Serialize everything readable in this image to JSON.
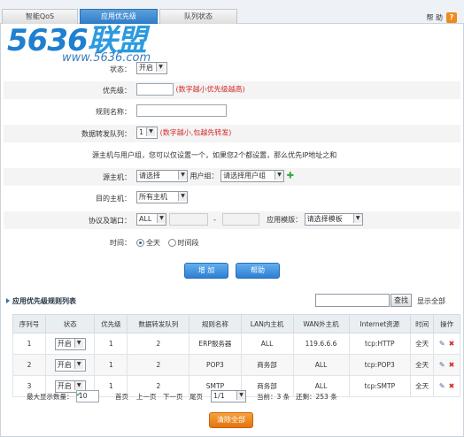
{
  "tabs": [
    "智能QoS",
    "应用优先级",
    "队列状态"
  ],
  "help_label": "帮 助",
  "help_icon": "?",
  "logo": {
    "text": "5636",
    "cn": "联盟",
    "url": "www.5636.com"
  },
  "form": {
    "status_label": "状态：",
    "status_value": "开启",
    "priority_label": "优先级：",
    "priority_hint": "(数字越小优先级越高)",
    "rule_name_label": "规则名称：",
    "queue_label": "数据转发队列：",
    "queue_value": "1",
    "queue_hint": "(数字越小,包越先转发)",
    "note": "源主机与用户组，您可以仅设置一个，如果您2个都设置，那么优先IP地址之和",
    "src_host_label": "源主机：",
    "src_host_value": "请选择",
    "user_group_label": "用户组：",
    "user_group_value": "请选择用户组",
    "dst_queue_label": "目的主机：",
    "dst_queue_value": "所有主机",
    "proto_label": "协议及端口：",
    "proto_value": "ALL",
    "port_sep": "-",
    "app_template_label": "应用模版：",
    "app_template_value": "请选择模板",
    "time_label": "时间：",
    "time_opt1": "全天",
    "time_opt2": "时间段",
    "add_button": "增 加",
    "help_button": "帮助"
  },
  "list": {
    "title": "应用优先级规则列表",
    "search_button": "查找",
    "show_all": "显示全部",
    "columns": [
      "序列号",
      "状态",
      "优先级",
      "数据转发队列",
      "规则名称",
      "LAN内主机",
      "WAN外主机",
      "Internet资源",
      "时间",
      "操作"
    ],
    "rows": [
      {
        "id": "1",
        "status": "开启",
        "priority": "1",
        "queue": "2",
        "name": "ERP服务器",
        "lan": "ALL",
        "wan": "119.6.6.6",
        "res": "tcp:HTTP",
        "time": "全天"
      },
      {
        "id": "2",
        "status": "开启",
        "priority": "1",
        "queue": "2",
        "name": "POP3",
        "lan": "商务部",
        "wan": "ALL",
        "res": "tcp:POP3",
        "time": "全天"
      },
      {
        "id": "3",
        "status": "开启",
        "priority": "1",
        "queue": "2",
        "name": "SMTP",
        "lan": "商务部",
        "wan": "ALL",
        "res": "tcp:SMTP",
        "time": "全天"
      }
    ],
    "pager": {
      "max_label": "最大显示数量：",
      "max_value": "10",
      "first": "首页",
      "prev": "上一页",
      "next": "下一页",
      "last": "尾页",
      "page_value": "1/1",
      "current": "当前：3 条",
      "total": "还剩：253 条"
    },
    "clear_button": "清除全部"
  }
}
